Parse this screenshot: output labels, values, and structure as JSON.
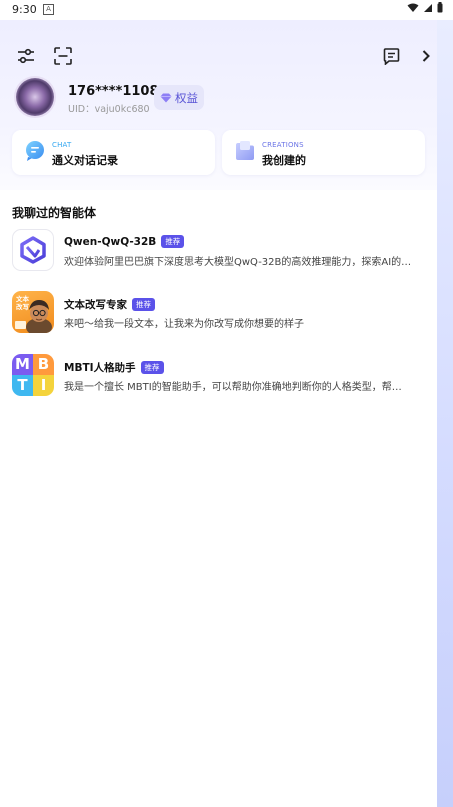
{
  "status_bar": {
    "time": "9:30",
    "notification_glyph": "A"
  },
  "header": {
    "user": {
      "phone": "176****1108",
      "uid": "UID：vaju0kc680"
    },
    "rights_badge": "权益"
  },
  "cards": [
    {
      "kicker": "CHAT",
      "label": "通义对话记录"
    },
    {
      "kicker": "CREATIONS",
      "label": "我创建的"
    }
  ],
  "section_title": "我聊过的智能体",
  "agents": [
    {
      "name": "Qwen-QwQ-32B",
      "tag": "推荐",
      "desc": "欢迎体验阿里巴巴旗下深度思考大模型QwQ-32B的高效推理能力，探索AI的…"
    },
    {
      "name": "文本改写专家",
      "tag": "推荐",
      "desc": "来吧～给我一段文本，让我来为你改写成你想要的样子",
      "avatar_text": "文本改写"
    },
    {
      "name": "MBTI人格助手",
      "tag": "推荐",
      "desc": "我是一个擅长 MBTI的智能助手，可以帮助你准确地判断你的人格类型，帮…",
      "avatar_letters": [
        "M",
        "B",
        "T",
        "I"
      ]
    }
  ],
  "colors": {
    "accent": "#5b52e9",
    "chat_kicker": "#31a6f0",
    "creations_kicker": "#6b74e6"
  },
  "icons": [
    "filter-sliders-icon",
    "scan-icon",
    "message-icon",
    "chevron-right-icon",
    "diamond-icon",
    "chat-bubble-icon",
    "folder-icon",
    "wifi-icon",
    "signal-icon",
    "battery-icon"
  ]
}
